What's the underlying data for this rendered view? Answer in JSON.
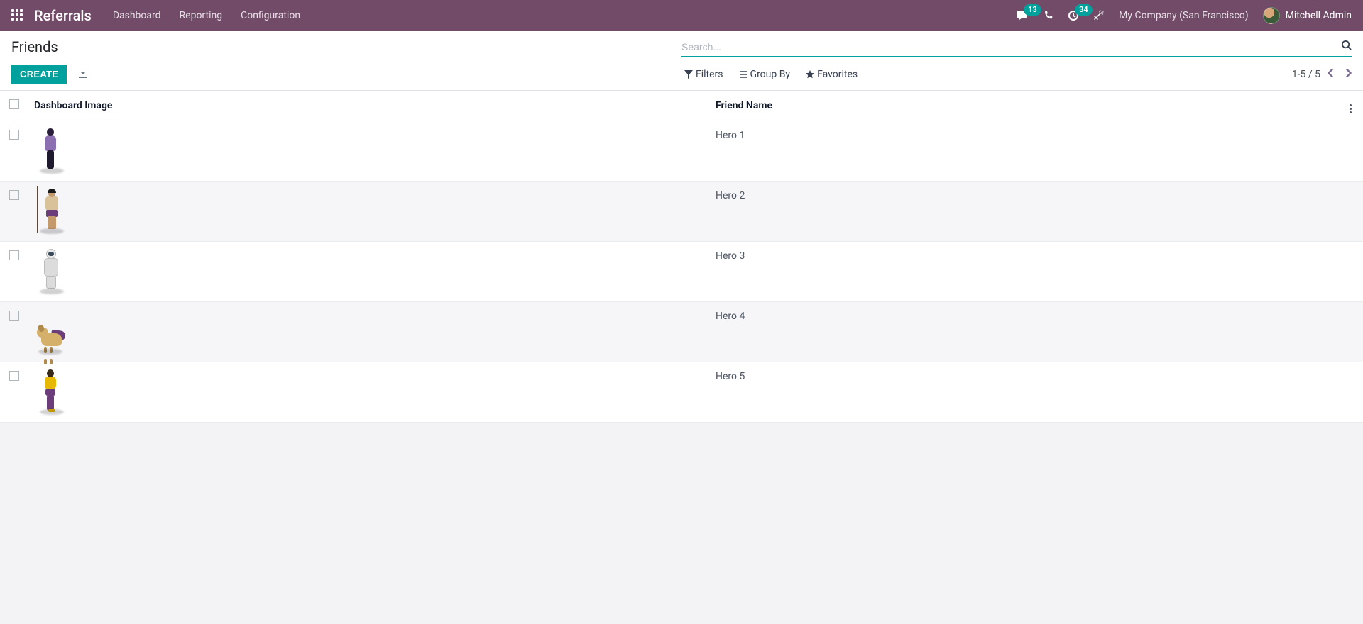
{
  "topnav": {
    "brand": "Referrals",
    "menu": [
      "Dashboard",
      "Reporting",
      "Configuration"
    ],
    "messages_badge": "13",
    "activities_badge": "34",
    "company": "My Company (San Francisco)",
    "user": "Mitchell Admin"
  },
  "page": {
    "title": "Friends",
    "create_label": "CREATE"
  },
  "search": {
    "placeholder": "Search...",
    "filters_label": "Filters",
    "groupby_label": "Group By",
    "favorites_label": "Favorites"
  },
  "pager": {
    "text": "1-5 / 5"
  },
  "table": {
    "columns": {
      "image": "Dashboard Image",
      "name": "Friend Name"
    },
    "rows": [
      {
        "name": "Hero 1",
        "figure": "h1"
      },
      {
        "name": "Hero 2",
        "figure": "h2"
      },
      {
        "name": "Hero 3",
        "figure": "h3"
      },
      {
        "name": "Hero 4",
        "figure": "h4"
      },
      {
        "name": "Hero 5",
        "figure": "h5"
      }
    ]
  }
}
